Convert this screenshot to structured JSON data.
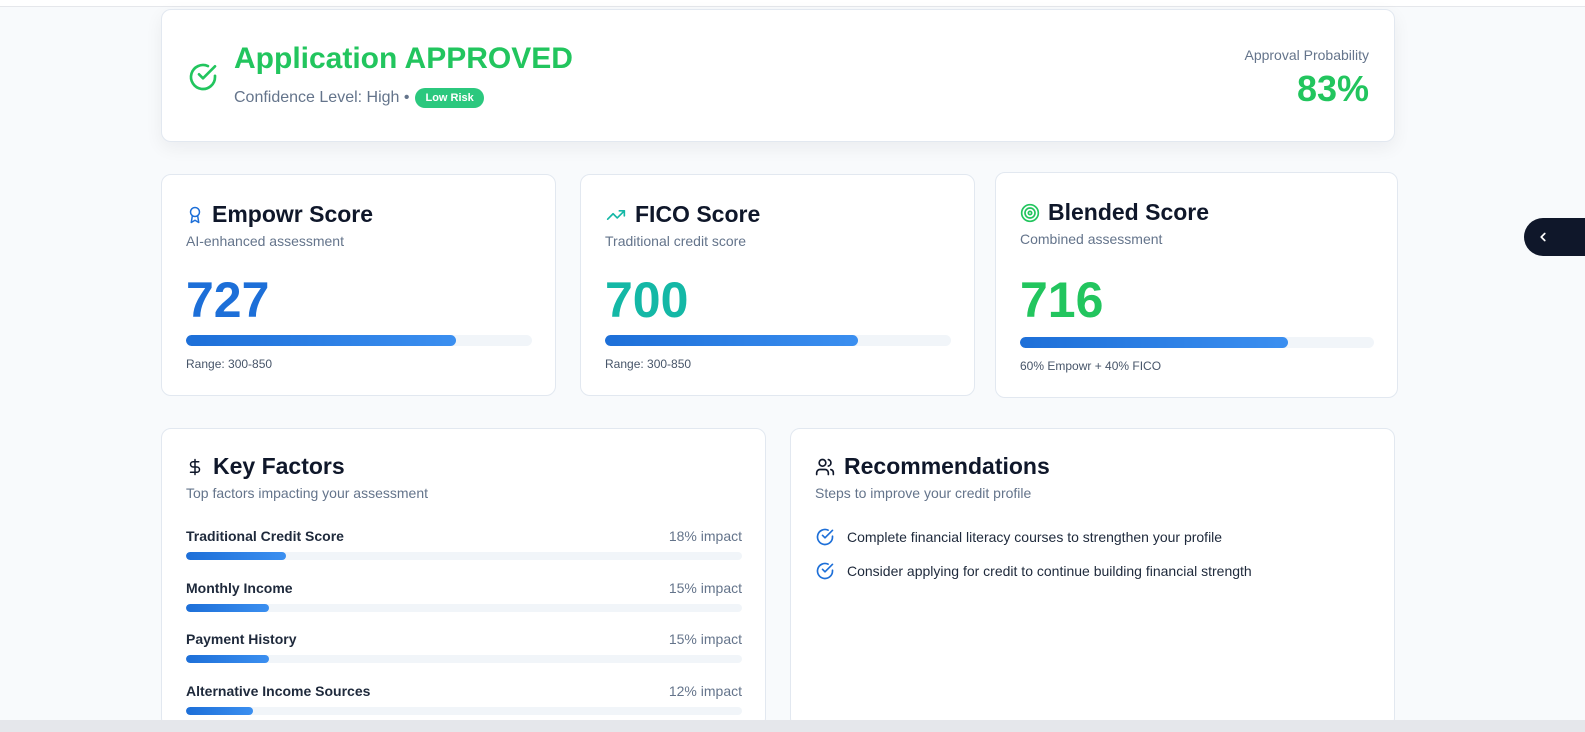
{
  "result": {
    "title": "Application APPROVED",
    "confidence": "Confidence Level: High •",
    "risk_badge": "Low Risk",
    "probability_label": "Approval Probability",
    "probability": "83%",
    "probability_value": 0.83
  },
  "scores": [
    {
      "title": "Empowr Score",
      "desc": "AI-enhanced assessment",
      "value": "727",
      "note": "Range: 300-850",
      "icon": "award-icon",
      "color": "#1d6fd8",
      "fill": 0.78
    },
    {
      "title": "FICO Score",
      "desc": "Traditional credit score",
      "value": "700",
      "note": "Range: 300-850",
      "icon": "trending-up-icon",
      "color": "#14b8a6",
      "fill": 0.73
    },
    {
      "title": "Blended Score",
      "desc": "Combined assessment",
      "value": "716",
      "note": "60% Empowr + 40% FICO",
      "icon": "target-icon",
      "color": "#22c55e",
      "fill": 0.756
    }
  ],
  "key_factors": {
    "title": "Key Factors",
    "desc": "Top factors impacting your assessment",
    "items": [
      {
        "name": "Traditional Credit Score",
        "impact": "18% impact",
        "fill": 0.18
      },
      {
        "name": "Monthly Income",
        "impact": "15% impact",
        "fill": 0.15
      },
      {
        "name": "Payment History",
        "impact": "15% impact",
        "fill": 0.15
      },
      {
        "name": "Alternative Income Sources",
        "impact": "12% impact",
        "fill": 0.12
      }
    ]
  },
  "recommendations": {
    "title": "Recommendations",
    "desc": "Steps to improve your credit profile",
    "items": [
      "Complete financial literacy courses to strengthen your profile",
      "Consider applying for credit to continue building financial strength"
    ]
  },
  "colors": {
    "success": "#22c55e",
    "primary": "#1d6fd8",
    "teal": "#14b8a6",
    "dark": "#0f172a"
  }
}
